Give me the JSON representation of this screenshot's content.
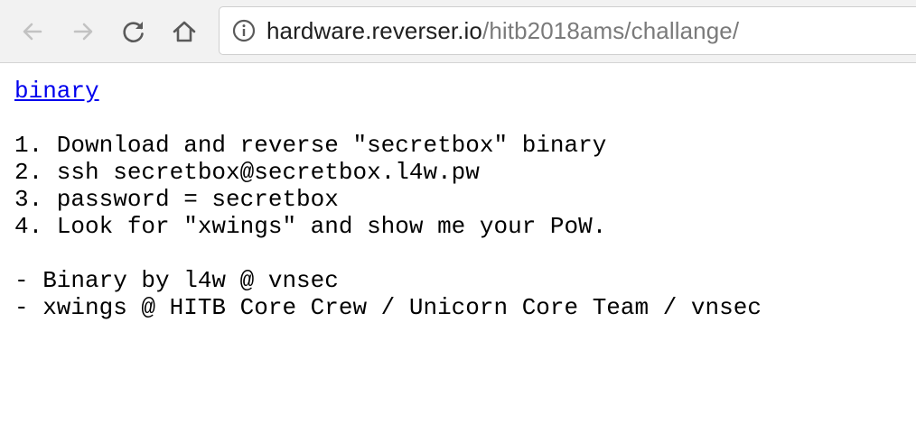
{
  "browser": {
    "url_host": "hardware.reverser.io",
    "url_path": "/hitb2018ams/challange/"
  },
  "icons": {
    "back": "back-arrow-icon",
    "forward": "forward-arrow-icon",
    "reload": "reload-icon",
    "home": "home-icon",
    "info": "info-icon"
  },
  "page": {
    "link_label": "binary",
    "steps": [
      "1. Download and reverse \"secretbox\" binary",
      "2. ssh secretbox@secretbox.l4w.pw",
      "3. password = secretbox",
      "4. Look for \"xwings\" and show me your PoW."
    ],
    "credits": [
      "- Binary by l4w @ vnsec",
      "- xwings @ HITB Core Crew / Unicorn Core Team / vnsec"
    ]
  }
}
